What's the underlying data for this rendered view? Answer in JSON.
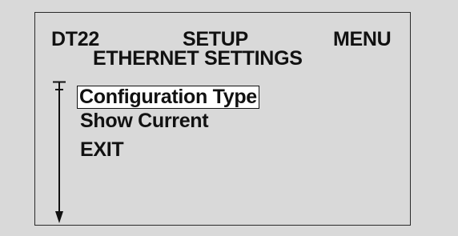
{
  "header": {
    "left": "DT22",
    "center": "SETUP",
    "right": "MENU",
    "subtitle": "ETHERNET SETTINGS"
  },
  "menu": {
    "items": [
      {
        "label": "Configuration Type",
        "selected": true
      },
      {
        "label": "Show Current",
        "selected": false
      },
      {
        "label": "EXIT",
        "selected": false
      }
    ]
  },
  "scroll_indicator": {
    "position": "top"
  },
  "colors": {
    "background": "#d9d9d9",
    "text": "#111111",
    "highlight": "#ffffff",
    "border": "#2a2a2a"
  }
}
